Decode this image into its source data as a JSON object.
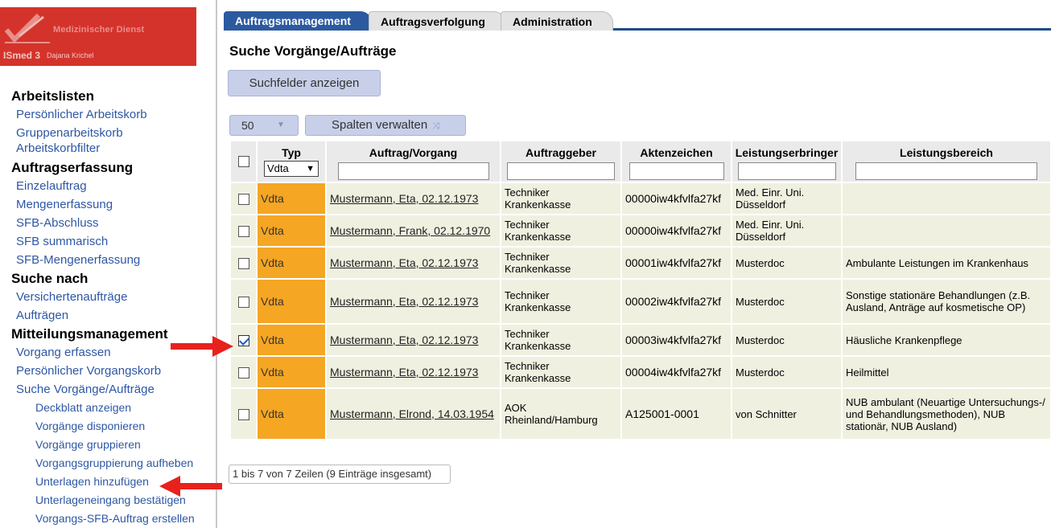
{
  "logo": {
    "org": "Medizinischer Dienst",
    "app": "ISmed 3",
    "user": "Dajana Krichel"
  },
  "sidebar": {
    "sections": [
      {
        "title": "Arbeitslisten",
        "items": [
          "Persönlicher Arbeitskorb",
          "Gruppenarbeitskorb",
          "Arbeitskorbfilter"
        ]
      },
      {
        "title": "Auftragserfassung",
        "items": [
          "Einzelauftrag",
          "Mengenerfassung",
          "SFB-Abschluss",
          "SFB summarisch",
          "SFB-Mengenerfassung"
        ]
      },
      {
        "title": "Suche nach",
        "items": [
          "Versichertenaufträge",
          "Aufträgen"
        ]
      },
      {
        "title": "Mitteilungsmanagement",
        "items": [
          "Vorgang erfassen",
          "Persönlicher Vorgangskorb",
          "Suche Vorgänge/Aufträge"
        ]
      }
    ],
    "subitems": [
      "Deckblatt anzeigen",
      "Vorgänge disponieren",
      "Vorgänge gruppieren",
      "Vorgangsgruppierung aufheben",
      "Unterlagen hinzufügen",
      "Unterlageneingang bestätigen",
      "Vorgangs-SFB-Auftrag erstellen"
    ]
  },
  "tabs": [
    "Auftragsmanagement",
    "Auftragsverfolgung",
    "Administration"
  ],
  "main": {
    "title": "Suche Vorgänge/Aufträge",
    "show_fields_button": "Suchfelder anzeigen",
    "page_size": "50",
    "manage_columns_button": "Spalten verwalten",
    "footer": "1 bis 7 von 7 Zeilen (9 Einträge insgesamt)"
  },
  "table": {
    "headers": [
      "Typ",
      "Auftrag/Vorgang",
      "Auftraggeber",
      "Aktenzeichen",
      "Leistungserbringer",
      "Leistungsbereich"
    ],
    "typ_filter": "Vdta",
    "rows": [
      {
        "checked": false,
        "typ": "Vdta",
        "auftrag": "Mustermann, Eta, 02.12.1973",
        "auftraggeber": "Techniker Krankenkasse",
        "aktenzeichen": "00000iw4kfvlfa27kf",
        "leistungserbringer": "Med. Einr. Uni. Düsseldorf",
        "leistungsbereich": ""
      },
      {
        "checked": false,
        "typ": "Vdta",
        "auftrag": "Mustermann, Frank, 02.12.1970",
        "auftraggeber": "Techniker Krankenkasse",
        "aktenzeichen": "00000iw4kfvlfa27kf",
        "leistungserbringer": "Med. Einr. Uni. Düsseldorf",
        "leistungsbereich": ""
      },
      {
        "checked": false,
        "typ": "Vdta",
        "auftrag": "Mustermann, Eta, 02.12.1973",
        "auftraggeber": "Techniker Krankenkasse",
        "aktenzeichen": "00001iw4kfvlfa27kf",
        "leistungserbringer": "Musterdoc",
        "leistungsbereich": "Ambulante Leistungen im Krankenhaus"
      },
      {
        "checked": false,
        "typ": "Vdta",
        "auftrag": "Mustermann, Eta, 02.12.1973",
        "auftraggeber": "Techniker Krankenkasse",
        "aktenzeichen": "00002iw4kfvlfa27kf",
        "leistungserbringer": "Musterdoc",
        "leistungsbereich": "Sonstige stationäre Behandlungen (z.B. Ausland, Anträge auf kosmetische OP)"
      },
      {
        "checked": true,
        "typ": "Vdta",
        "auftrag": "Mustermann, Eta, 02.12.1973",
        "auftraggeber": "Techniker Krankenkasse",
        "aktenzeichen": "00003iw4kfvlfa27kf",
        "leistungserbringer": "Musterdoc",
        "leistungsbereich": "Häusliche Krankenpflege"
      },
      {
        "checked": false,
        "typ": "Vdta",
        "auftrag": "Mustermann, Eta, 02.12.1973",
        "auftraggeber": "Techniker Krankenkasse",
        "aktenzeichen": "00004iw4kfvlfa27kf",
        "leistungserbringer": "Musterdoc",
        "leistungsbereich": "Heilmittel"
      },
      {
        "checked": false,
        "typ": "Vdta",
        "auftrag": "Mustermann, Elrond, 14.03.1954",
        "auftraggeber": "AOK Rheinland/Hamburg",
        "aktenzeichen": "A125001-0001",
        "leistungserbringer": "von Schnitter",
        "leistungsbereich": "NUB ambulant (Neuartige Untersuchungs-/ und Behandlungsmethoden), NUB stationär, NUB Ausland)"
      }
    ]
  },
  "colors": {
    "accent_tab": "#2c5aa0",
    "typ_cell": "#f5a623",
    "link": "#2e57a5",
    "annotation_arrow": "#e8211d",
    "logo_bg": "#d4332b"
  },
  "icons": {
    "logo_mark": "check-swoosh-icon",
    "annotation": "red-arrow-icon",
    "columns_button": "shuffle-icon"
  }
}
